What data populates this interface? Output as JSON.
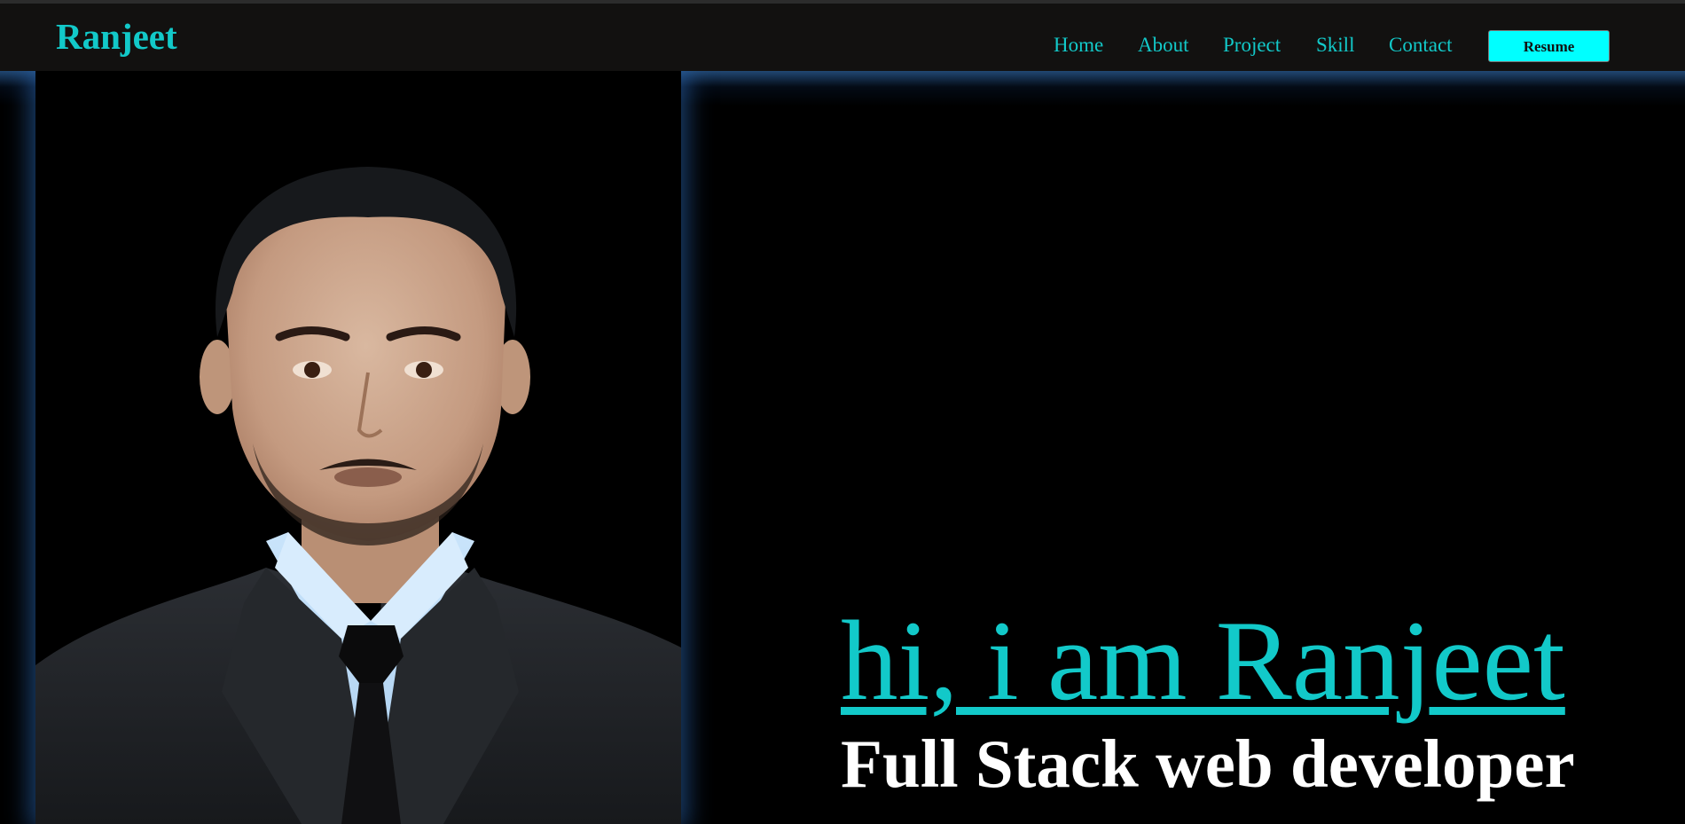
{
  "brand": {
    "name": "Ranjeet"
  },
  "nav": {
    "items": [
      {
        "label": "Home"
      },
      {
        "label": "About"
      },
      {
        "label": "Project"
      },
      {
        "label": "Skill"
      },
      {
        "label": "Contact"
      }
    ],
    "resume_label": "Resume"
  },
  "hero": {
    "greeting": "hi, i am Ranjeet",
    "role": "Full Stack web developer",
    "photo_icon": "profile-photo"
  },
  "colors": {
    "accent": "#12c9c9",
    "resume_button": "#00ffff",
    "navbar_bg": "#121110",
    "page_bg": "#000000",
    "glow": "#3c82d2"
  }
}
